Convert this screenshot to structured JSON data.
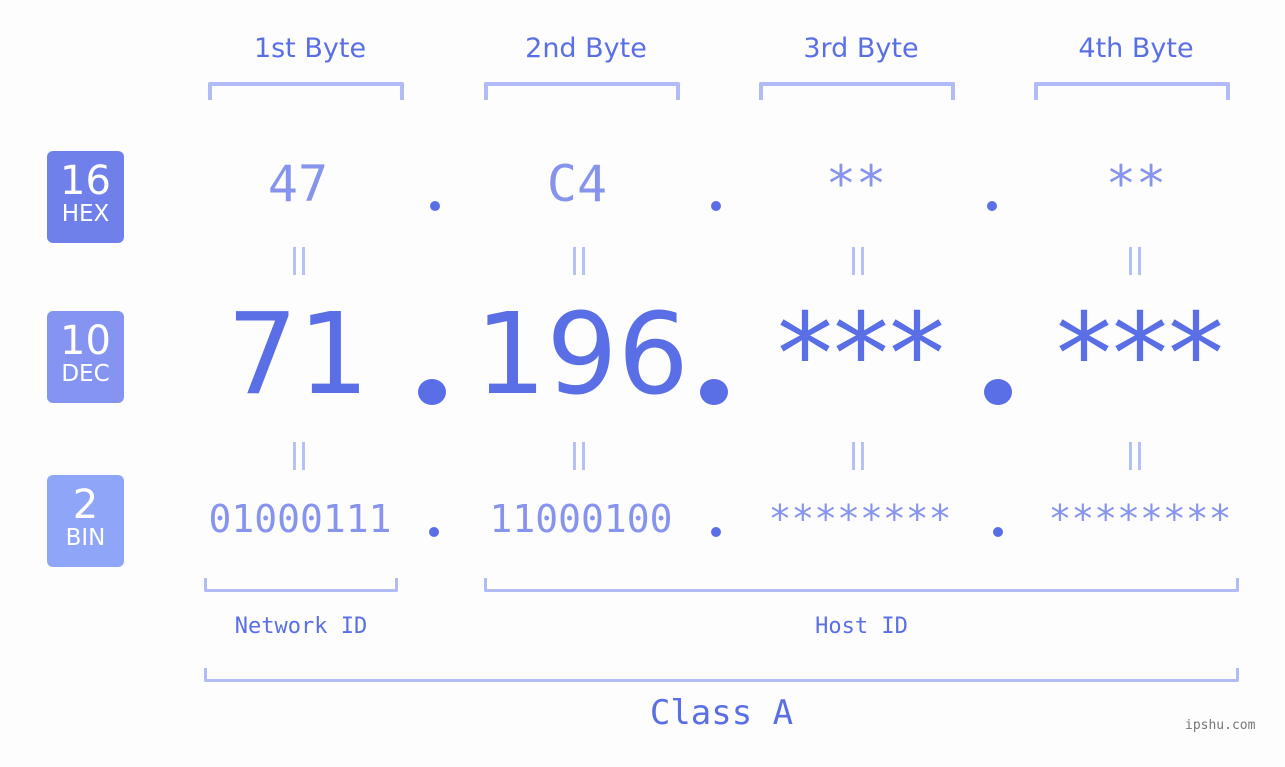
{
  "headers": [
    "1st Byte",
    "2nd Byte",
    "3rd Byte",
    "4th Byte"
  ],
  "badges": {
    "hex": {
      "num": "16",
      "label": "HEX",
      "color": "#7080ea"
    },
    "dec": {
      "num": "10",
      "label": "DEC",
      "color": "#8594f0"
    },
    "bin": {
      "num": "2",
      "label": "BIN",
      "color": "#8fa6f8"
    }
  },
  "hex": [
    "47",
    "C4",
    "**",
    "**"
  ],
  "dec": [
    "71",
    "196",
    "***",
    "***"
  ],
  "bin": [
    "01000111",
    "11000100",
    "********",
    "********"
  ],
  "labels": {
    "network": "Network ID",
    "host": "Host ID",
    "class": "Class A"
  },
  "watermark": "ipshu.com",
  "colors": {
    "primary": "#5a6fe6",
    "light": "#8794ed",
    "bracket": "#b1bbf5"
  }
}
